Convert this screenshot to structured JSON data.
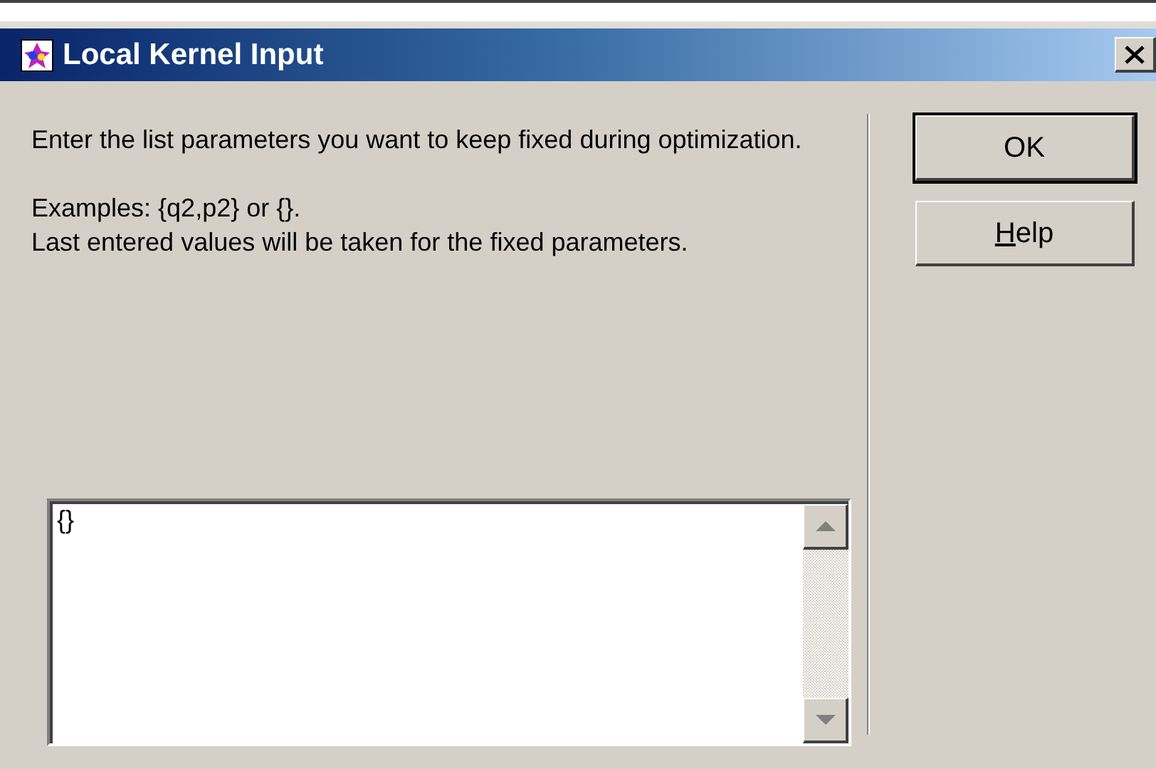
{
  "window": {
    "title": "Local Kernel Input"
  },
  "message": [
    "Enter the list parameters you want to keep fixed during optimization.",
    "Examples: {q2,p2} or {}.\nLast entered values will be taken for the fixed parameters."
  ],
  "input": {
    "value": "{}"
  },
  "buttons": [
    {
      "label": "OK",
      "default": true,
      "first_letter_underlined": false
    },
    {
      "label": "Help",
      "default": false,
      "first_letter_underlined": true
    }
  ]
}
